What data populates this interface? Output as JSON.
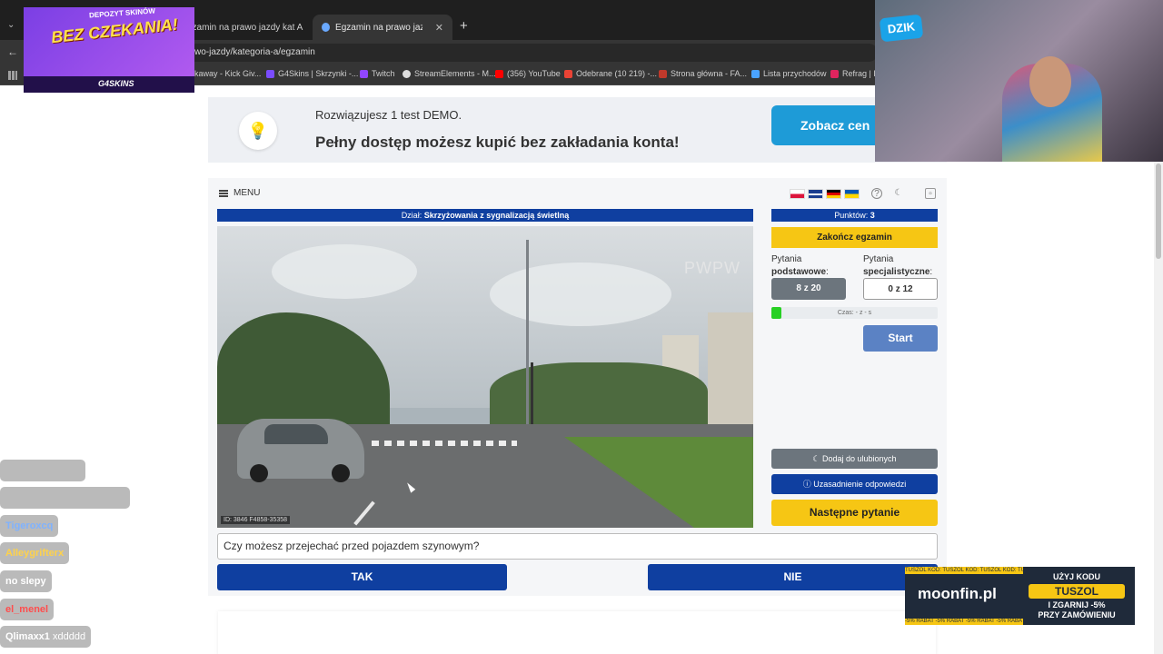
{
  "browser": {
    "tabs": [
      {
        "label": "gzamin na prawo jazdy kat A"
      },
      {
        "label": "Egzamin na prawo jazdy kat B"
      }
    ],
    "new_tab": "+",
    "url": "wo-jazdy/kategoria-a/egzamin",
    "bookmarks": [
      "kaway - Kick Giv...",
      "G4Skins | Skrzynki -...",
      "Twitch",
      "StreamElements - M...",
      "(356) YouTube",
      "Odebrane (10 219) -...",
      "Strona główna - FA...",
      "Lista przychodów",
      "Refrag | D"
    ]
  },
  "banner": {
    "line1": "Rozwiązujesz 1 test DEMO.",
    "line2": "Pełny dostęp możesz kupić bez zakładania konta!",
    "button": "Zobacz cen"
  },
  "exam": {
    "menu_label": "MENU",
    "category_prefix": "Dział:",
    "category": "Skrzyżowania z sygnalizacją świetlną",
    "points_label": "Punktów:",
    "points": "3",
    "finish_button": "Zakończ egzamin",
    "basic_label_1": "Pytania",
    "basic_label_2": "podstawowe",
    "basic_count": "8 z 20",
    "special_label_1": "Pytania",
    "special_label_2": "specjalistyczne",
    "special_count": "0 z 12",
    "timer_text": "Czas: - z - s",
    "timer_progress": 0.06,
    "start_button": "Start",
    "favorite_button": "Dodaj do ulubionych",
    "justification_button": "Uzasadnienie odpowiedzi",
    "next_button": "Następne pytanie",
    "question": "Czy możesz przejechać przed pojazdem szynowym?",
    "answer_yes": "TAK",
    "answer_no": "NIE",
    "video_watermark": "PWPW",
    "video_id": "ID: 3846 F4858-35358"
  },
  "overlays": {
    "g4_title": "BEZ CZEKANIA!",
    "g4_subtitle": "DEPOZYT SKINÓW",
    "g4_logo": "G4SKINS",
    "cam_logo": "DZIK",
    "chat": [
      {
        "user": "",
        "text": "",
        "color": "#bbbbbb"
      },
      {
        "user": "",
        "text": "",
        "color": "#f0a0a0"
      },
      {
        "user": "Tigeroxcq",
        "text": "",
        "color": "#7fb2ff"
      },
      {
        "user": "Alleygrifterx",
        "text": "",
        "color": "#ffd24a"
      },
      {
        "user": "",
        "text": "no slepy",
        "color": "#c58cff"
      },
      {
        "user": "el_menel",
        "text": "",
        "color": "#ff4d4d"
      },
      {
        "user": "Qlimaxx1",
        "text": "xddddd",
        "color": "#ffffff"
      }
    ],
    "moonfin_logo": "moonfin.pl",
    "moonfin_line1": "UŻYJ KODU",
    "moonfin_code": "TUSZOL",
    "moonfin_line2": "I ZGARNIJ -5%",
    "moonfin_line3": "PRZY ZAMÓWIENIU",
    "moonfin_strip_top": "TUSZOL KOD: TUSZOL KOD: TUSZOL KOD: TUSZOL KOD",
    "moonfin_strip_bottom": "-5% RABAT -5% RABAT -5% RABAT -5% RABAT"
  }
}
